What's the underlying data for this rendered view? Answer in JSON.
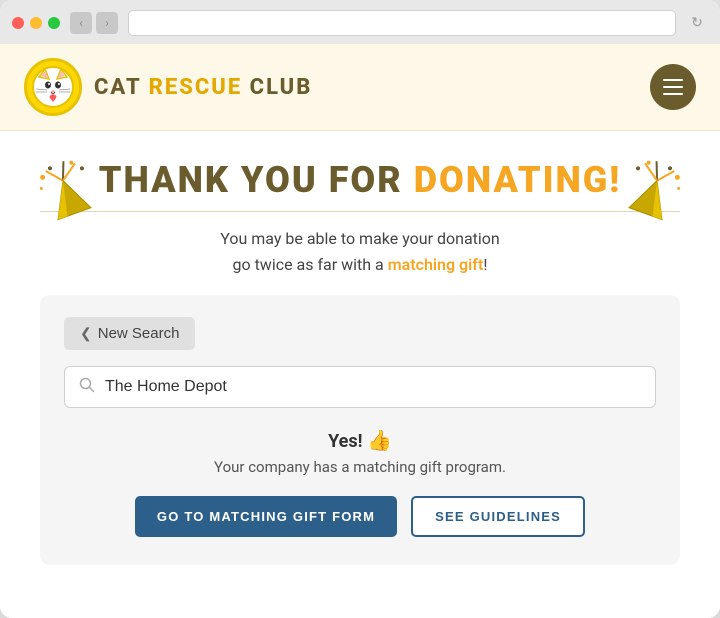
{
  "browser": {
    "address_text": ""
  },
  "header": {
    "logo_emoji": "🐱",
    "title_cat": "CAT",
    "title_rescue": "RESCUE",
    "title_club": "CLUB"
  },
  "main": {
    "thank_you_text": "THANK YOU FOR",
    "donating_text": "DONATING!",
    "subtitle_line1": "You may be able to make your donation",
    "subtitle_line2": "go twice as far with a",
    "matching_gift_text": "matching gift",
    "subtitle_end": "!",
    "search_card": {
      "new_search_label": "New Search",
      "search_placeholder": "The Home Depot",
      "result_yes": "Yes!",
      "result_description": "Your company has a matching gift program.",
      "btn_primary_label": "GO TO MATCHING GIFT FORM",
      "btn_secondary_label": "SEE GUIDELINES"
    }
  }
}
